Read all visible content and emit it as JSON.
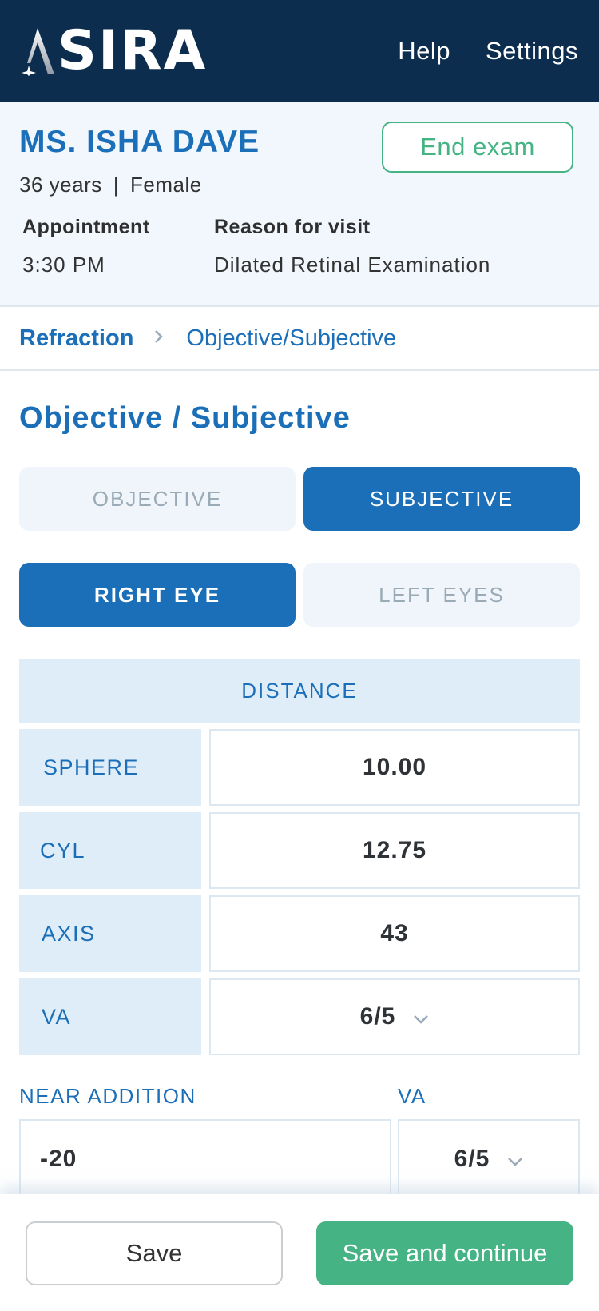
{
  "header": {
    "logo_text": "SIRA",
    "logo_full": "ASIRA",
    "nav": {
      "help": "Help",
      "settings": "Settings"
    }
  },
  "patient": {
    "name": "MS. ISHA DAVE",
    "age": "36 years",
    "separator": "|",
    "gender": "Female",
    "end_exam_label": "End exam",
    "appointment_label": "Appointment",
    "appointment_value": "3:30 PM",
    "reason_label": "Reason for visit",
    "reason_value": "Dilated Retinal Examination"
  },
  "breadcrumb": {
    "root": "Refraction",
    "current": "Objective/Subjective"
  },
  "section_title": "Objective / Subjective",
  "mode_tabs": {
    "objective": "OBJECTIVE",
    "subjective": "SUBJECTIVE",
    "selected": "subjective"
  },
  "eye_tabs": {
    "right": "RIGHT EYE",
    "left": "LEFT EYES",
    "selected": "right"
  },
  "distance": {
    "header": "DISTANCE",
    "rows": [
      {
        "label": "SPHERE",
        "value": "10.00"
      },
      {
        "label": "CYL",
        "value": "12.75"
      },
      {
        "label": "AXIS",
        "value": "43"
      },
      {
        "label": "VA",
        "value": "6/5"
      }
    ]
  },
  "near": {
    "addition_label": "NEAR ADDITION",
    "addition_value": "-20",
    "va_label": "VA",
    "va_value": "6/5"
  },
  "footer": {
    "save": "Save",
    "save_continue": "Save and continue"
  },
  "colors": {
    "header_bg": "#0d2d4e",
    "primary_blue": "#1b6fb8",
    "accent_green": "#45b384",
    "panel_bg": "#f1f7fc",
    "label_cell_bg": "#dfedf9"
  }
}
